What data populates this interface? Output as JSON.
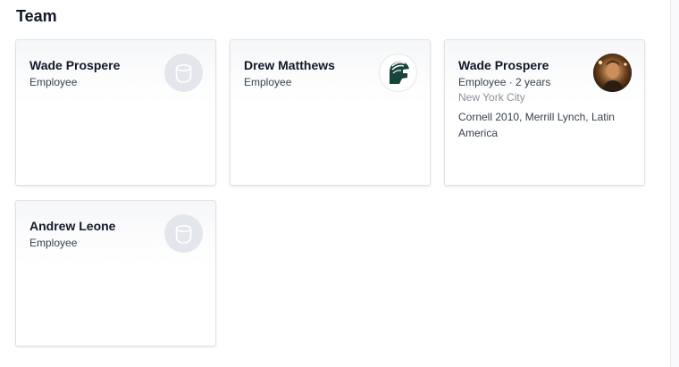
{
  "page": {
    "title": "Team"
  },
  "team": {
    "members": [
      {
        "name": "Wade Prospere",
        "role": "Employee",
        "avatar": "placeholder-user-icon"
      },
      {
        "name": "Drew Matthews",
        "role": "Employee",
        "avatar": "spartan-helmet-logo"
      },
      {
        "name": "Wade Prospere",
        "role": "Employee · 2 years",
        "location": "New York City",
        "bio": "Cornell 2010, Merrill Lynch, Latin America",
        "avatar": "profile-photo"
      },
      {
        "name": "Andrew Leone",
        "role": "Employee",
        "avatar": "placeholder-user-icon"
      }
    ]
  },
  "colors": {
    "background": "#ffffff",
    "card_border": "#dfe3e8",
    "placeholder_avatar": "#e3e6ea",
    "logo_green": "#18453b",
    "muted_text": "#8a8f98"
  }
}
